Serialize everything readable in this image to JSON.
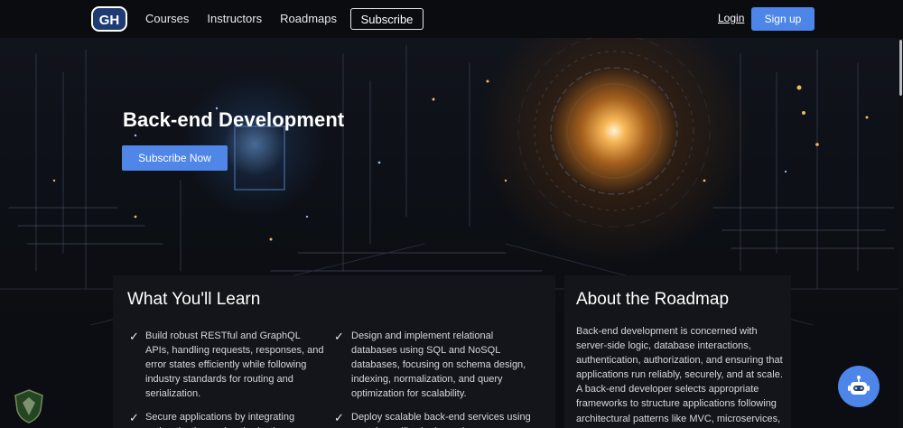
{
  "nav": {
    "logo_text": "GH",
    "links": [
      "Courses",
      "Instructors",
      "Roadmaps"
    ],
    "subscribe_label": "Subscribe",
    "login_label": "Login",
    "signup_label": "Sign up"
  },
  "hero": {
    "title": "Back-end Development",
    "cta_label": "Subscribe Now"
  },
  "learn": {
    "title": "What You'll Learn",
    "items": [
      "Build robust RESTful and GraphQL APIs, handling requests, responses, and error states efficiently while following industry standards for routing and serialization.",
      "Design and implement relational databases using SQL and NoSQL databases, focusing on schema design, indexing, normalization, and query optimization for scalability.",
      "Secure applications by integrating authentication and authorization",
      "Deploy scalable back-end services using containers (Docker), services"
    ]
  },
  "about": {
    "title": "About the Roadmap",
    "text": "Back-end development is concerned with server-side logic, database interactions, authentication, authorization, and ensuring that applications run reliably, securely, and at scale. A back-end developer selects appropriate frameworks to structure applications following architectural patterns like MVC, microservices, serverless"
  },
  "icons": {
    "check": "checkmark-icon",
    "chatbot": "chatbot-icon",
    "shield": "shield-logo-icon"
  },
  "colors": {
    "accent": "#4d86e8",
    "nav_bg": "#0a0c10",
    "panel_bg": "#13151b"
  }
}
